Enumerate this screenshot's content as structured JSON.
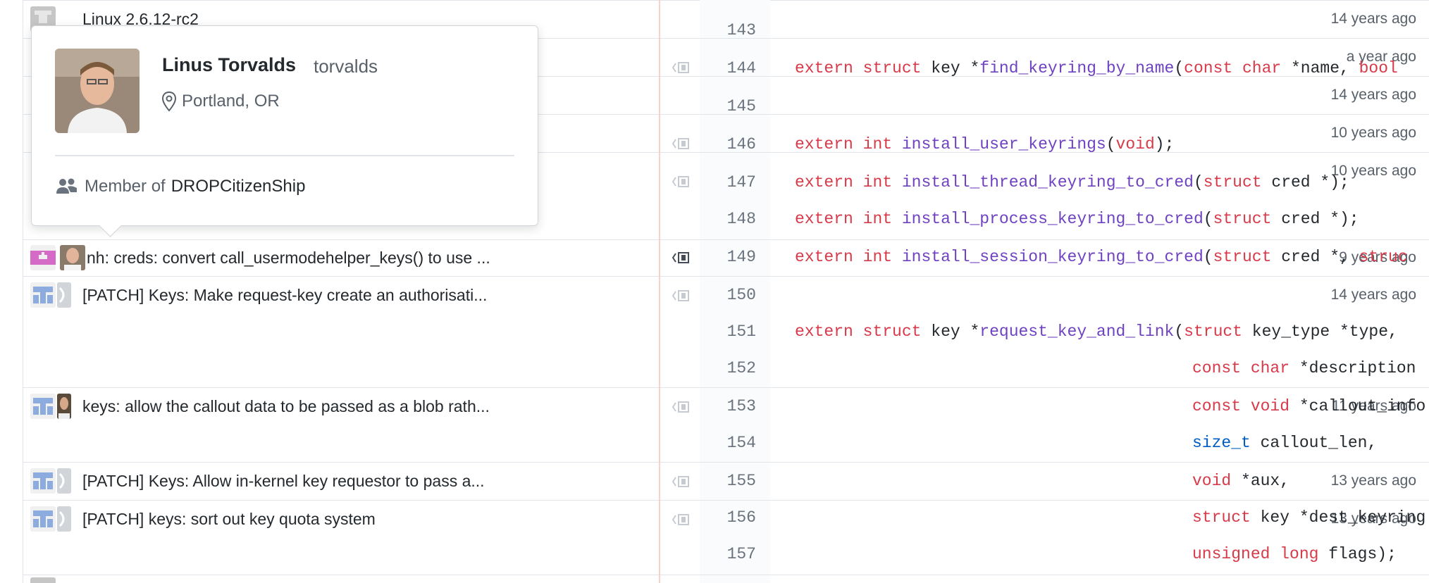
{
  "popover": {
    "name": "Linus Torvalds",
    "login": "torvalds",
    "location": "Portland, OR",
    "member_prefix": "Member of",
    "org": "DROPCitizenShip"
  },
  "hidden_commit_top": "Linux 2.6.12-rc2",
  "commits": [
    {
      "message": "",
      "age": "14 years ago"
    },
    {
      "message": "",
      "age": "a year ago"
    },
    {
      "message": "",
      "age": "14 years ago"
    },
    {
      "message": "",
      "age": "10 years ago"
    },
    {
      "message": "",
      "age": "10 years ago"
    },
    {
      "message": "nh: creds: convert call_usermodehelper_keys() to use ...",
      "age": "9 years ago"
    },
    {
      "message": "[PATCH] Keys: Make request-key create an authorisati...",
      "age": "14 years ago"
    },
    {
      "message": "keys: allow the callout data to be passed as a blob rath...",
      "age": "11 years ago"
    },
    {
      "message": "[PATCH] Keys: Allow in-kernel key requestor to pass a...",
      "age": "13 years ago"
    },
    {
      "message": "[PATCH] keys: sort out key quota system",
      "age": "13 years ago"
    }
  ],
  "lines": [
    {
      "num": "143"
    },
    {
      "num": "144"
    },
    {
      "num": "145"
    },
    {
      "num": "146"
    },
    {
      "num": "147"
    },
    {
      "num": "148"
    },
    {
      "num": "149"
    },
    {
      "num": "150"
    },
    {
      "num": "151"
    },
    {
      "num": "152"
    },
    {
      "num": "153"
    },
    {
      "num": "154"
    },
    {
      "num": "155"
    },
    {
      "num": "156"
    },
    {
      "num": "157"
    }
  ],
  "code": {
    "l144": {
      "a": "extern",
      "b": " ",
      "c": "struct",
      "d": " key *",
      "e": "find_keyring_by_name",
      "f": "(",
      "g": "const",
      "h": " ",
      "i": "char",
      "j": " *name, ",
      "k": "bool"
    },
    "l146": {
      "a": "extern",
      "b": " ",
      "c": "int",
      "d": " ",
      "e": "install_user_keyrings",
      "f": "(",
      "g": "void",
      "h": ");"
    },
    "l147": {
      "a": "extern",
      "b": " ",
      "c": "int",
      "d": " ",
      "e": "install_thread_keyring_to_cred",
      "f": "(",
      "g": "struct",
      "h": " cred *);"
    },
    "l148": {
      "a": "extern",
      "b": " ",
      "c": "int",
      "d": " ",
      "e": "install_process_keyring_to_cred",
      "f": "(",
      "g": "struct",
      "h": " cred *);"
    },
    "l149": {
      "a": "extern",
      "b": " ",
      "c": "int",
      "d": " ",
      "e": "install_session_keyring_to_cred",
      "f": "(",
      "g": "struct",
      "h": " cred *, ",
      "i": "struc"
    },
    "l151": {
      "a": "extern",
      "b": " ",
      "c": "struct",
      "d": " key *",
      "e": "request_key_and_link",
      "f": "(",
      "g": "struct",
      "h": " key_type *type,"
    },
    "l152": {
      "a": "const",
      "b": " ",
      "c": "char",
      "d": " *description"
    },
    "l153": {
      "a": "const",
      "b": " ",
      "c": "void",
      "d": " *callout_info"
    },
    "l154": {
      "a": "size_t",
      "b": " callout_len,"
    },
    "l155": {
      "a": "void",
      "b": " *aux,"
    },
    "l156": {
      "a": "struct",
      "b": " key *dest_keyring"
    },
    "l157": {
      "a": "unsigned",
      "b": " ",
      "c": "long",
      "d": " flags);"
    }
  },
  "icons": {
    "location": "location-pin-icon",
    "members": "people-icon",
    "reblame": "reblame-icon"
  },
  "colors": {
    "keyword": "#d73a49",
    "function": "#6f42c1",
    "type": "#005cc5",
    "identicon_blue": "#8cabde",
    "identicon_pink": "#d66bc7"
  }
}
